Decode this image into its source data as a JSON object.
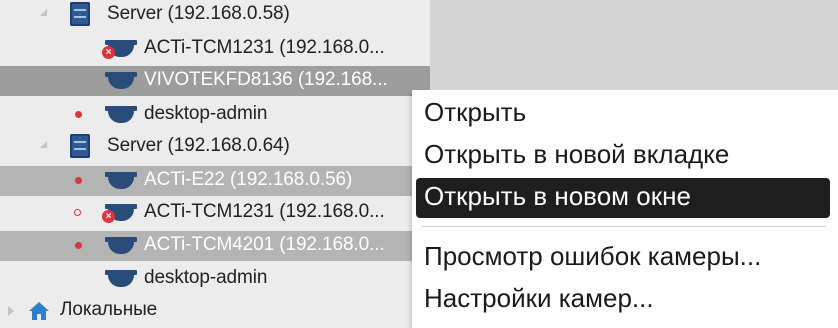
{
  "tree": {
    "items": [
      {
        "label": "Server (192.168.0.58)"
      },
      {
        "label": "ACTi-TCM1231 (192.168.0..."
      },
      {
        "label": "VIVOTEKFD8136 (192.168..."
      },
      {
        "label": "desktop-admin"
      },
      {
        "label": "Server (192.168.0.64)"
      },
      {
        "label": "ACTi-E22 (192.168.0.56)"
      },
      {
        "label": "ACTi-TCM1231 (192.168.0..."
      },
      {
        "label": "ACTi-TCM4201 (192.168.0..."
      },
      {
        "label": "desktop-admin"
      },
      {
        "label": "Локальные"
      }
    ]
  },
  "context_menu": {
    "items": [
      {
        "label": "Открыть"
      },
      {
        "label": "Открыть в новой вкладке"
      },
      {
        "label": "Открыть в новом окне"
      },
      {
        "label": "Просмотр ошибок камеры..."
      },
      {
        "label": "Настройки камер..."
      }
    ]
  },
  "colors": {
    "selected_row": "#9d9d9d",
    "highlight_menu": "#1e1e1e",
    "status_red": "#d9363e",
    "icon_blue": "#2a4c79"
  }
}
